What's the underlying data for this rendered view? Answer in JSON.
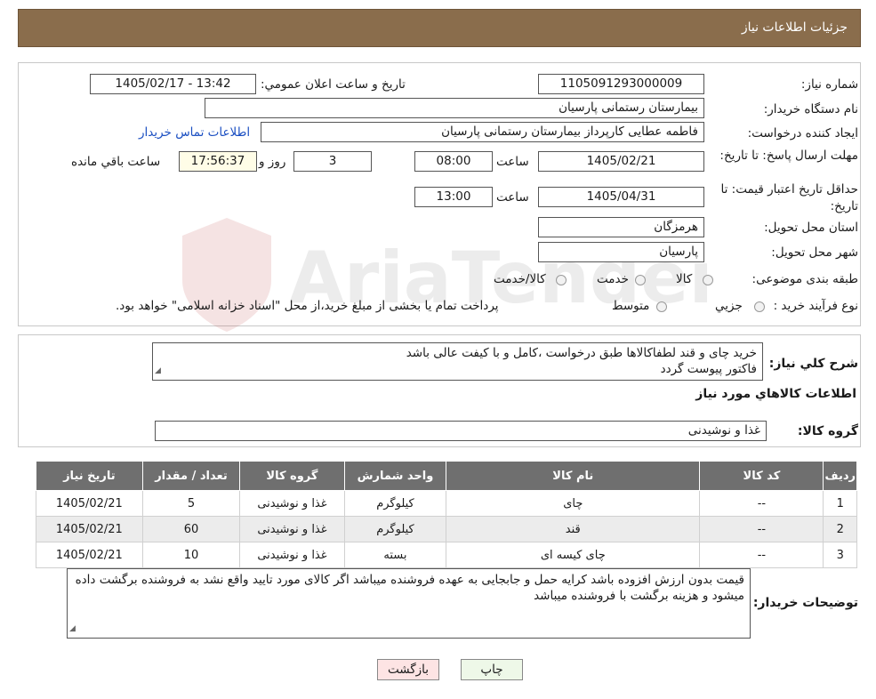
{
  "header": {
    "title": "جزئیات اطلاعات نیاز"
  },
  "form": {
    "need_number_label": "شماره نیاز:",
    "need_number": "1105091293000009",
    "announce_label": "تاریخ و ساعت اعلان عمومي:",
    "announce_value": "1405/02/17 - 13:42",
    "buyer_org_label": "نام دستگاه خريدار:",
    "buyer_org": "بیمارستان رستمانی پارسیان",
    "creator_label": "ايجاد كننده درخواست:",
    "creator": "فاطمه عطایی کارپرداز بیمارستان رستمانی پارسیان",
    "contact_link": "اطلاعات تماس خريدار",
    "deadline_label": "مهلت ارسال پاسخ: تا تاریخ:",
    "deadline_date": "1405/02/21",
    "hour_label": "ساعت",
    "deadline_time": "08:00",
    "days_value": "3",
    "days_label": "روز و",
    "remaining_time": "17:56:37",
    "remaining_label": "ساعت باقي مانده",
    "validity_label": "حداقل تاريخ اعتبار قيمت: تا تاریخ:",
    "validity_date": "1405/04/31",
    "validity_hour_label": "ساعت",
    "validity_time": "13:00",
    "province_label": "استان محل تحويل:",
    "province": "هرمزگان",
    "city_label": "شهر محل تحويل:",
    "city": "پارسیان",
    "category_label": "طبقه بندی موضوعی:",
    "category_options": [
      "کالا",
      "خدمت",
      "کالا/خدمت"
    ],
    "process_label": "نوع فرآيند خريد :",
    "process_options": [
      "جزيي",
      "متوسط"
    ],
    "process_note": "پرداخت تمام یا بخشی از مبلغ خرید،از محل \"اسناد خزانه اسلامی\" خواهد بود."
  },
  "description": {
    "label": "شرح كلي نياز:",
    "line1": "خرید چای و قند لطفاکالاها طبق درخواست ،کامل و با کیفت عالی باشد",
    "line2": "فاکتور پیوست گردد"
  },
  "goods": {
    "section_title": "اطلاعات كالاهاي مورد نياز",
    "group_label": "گروه کالا:",
    "group_value": "غذا و نوشیدنی",
    "columns": [
      "رديف",
      "كد كالا",
      "نام كالا",
      "واحد شمارش",
      "گروه كالا",
      "تعداد / مقدار",
      "تاريخ نياز"
    ],
    "rows": [
      [
        "1",
        "--",
        "چای",
        "کیلوگرم",
        "غذا و نوشیدنی",
        "5",
        "1405/02/21"
      ],
      [
        "2",
        "--",
        "قند",
        "کیلوگرم",
        "غذا و نوشیدنی",
        "60",
        "1405/02/21"
      ],
      [
        "3",
        "--",
        "چای کیسه ای",
        "بسته",
        "غذا و نوشیدنی",
        "10",
        "1405/02/21"
      ]
    ]
  },
  "buyer_notes": {
    "label": "توضيحات خريدار:",
    "text": "قیمت بدون ارزش افزوده باشد کرایه حمل و جابجایی به عهده فروشنده میباشد اگر کالای مورد تایید واقع نشد به فروشنده برگشت داده میشود و هزینه برگشت با فروشنده میباشد"
  },
  "buttons": {
    "print": "چاپ",
    "back": "بازگشت"
  },
  "watermark": {
    "text": "AriaTender.neT"
  },
  "colors": {
    "header": "#8a6d4c",
    "link": "#1b4fc2",
    "table_header": "#6f6f6f",
    "back_button": "#fde4e4",
    "print_button": "#eef8e8"
  }
}
